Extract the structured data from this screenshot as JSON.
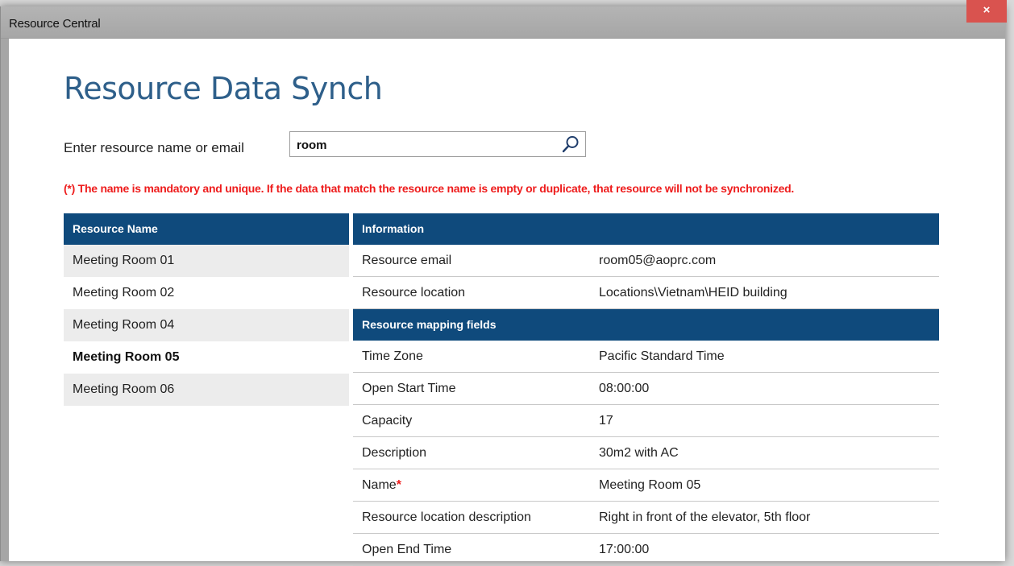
{
  "window": {
    "title": "Resource Central",
    "close_label": "×"
  },
  "page": {
    "title": "Resource Data Synch"
  },
  "search": {
    "label": "Enter resource name or email",
    "value": "room",
    "icon": "search-icon"
  },
  "notice": "(*) The name is mandatory and unique. If the data that match the resource name is empty or duplicate, that resource will not be synchronized.",
  "resource_list": {
    "header": "Resource Name",
    "items": [
      "Meeting Room 01",
      "Meeting Room 02",
      "Meeting Room 04",
      "Meeting Room 05",
      "Meeting Room 06"
    ],
    "selected": "Meeting Room 05"
  },
  "information": {
    "header": "Information",
    "rows": [
      {
        "label": "Resource email",
        "value": "room05@aoprc.com"
      },
      {
        "label": "Resource location",
        "value": "Locations\\Vietnam\\HEID building"
      }
    ]
  },
  "mapping": {
    "header": "Resource mapping fields",
    "rows": [
      {
        "label": "Time Zone",
        "value": "Pacific Standard Time"
      },
      {
        "label": "Open Start Time",
        "value": "08:00:00"
      },
      {
        "label": "Capacity",
        "value": "17"
      },
      {
        "label": "Description",
        "value": "30m2 with AC"
      },
      {
        "label": "Name",
        "required_mark": "*",
        "value": "Meeting Room 05"
      },
      {
        "label": "Resource location description",
        "value": "Right in front of the elevator, 5th floor"
      },
      {
        "label": "Open End Time",
        "value": "17:00:00"
      }
    ]
  },
  "colors": {
    "header_bg": "#0f4a7c",
    "title_color": "#2e5f8a",
    "notice_color": "#ee1c1c",
    "close_bg": "#d9534f"
  }
}
